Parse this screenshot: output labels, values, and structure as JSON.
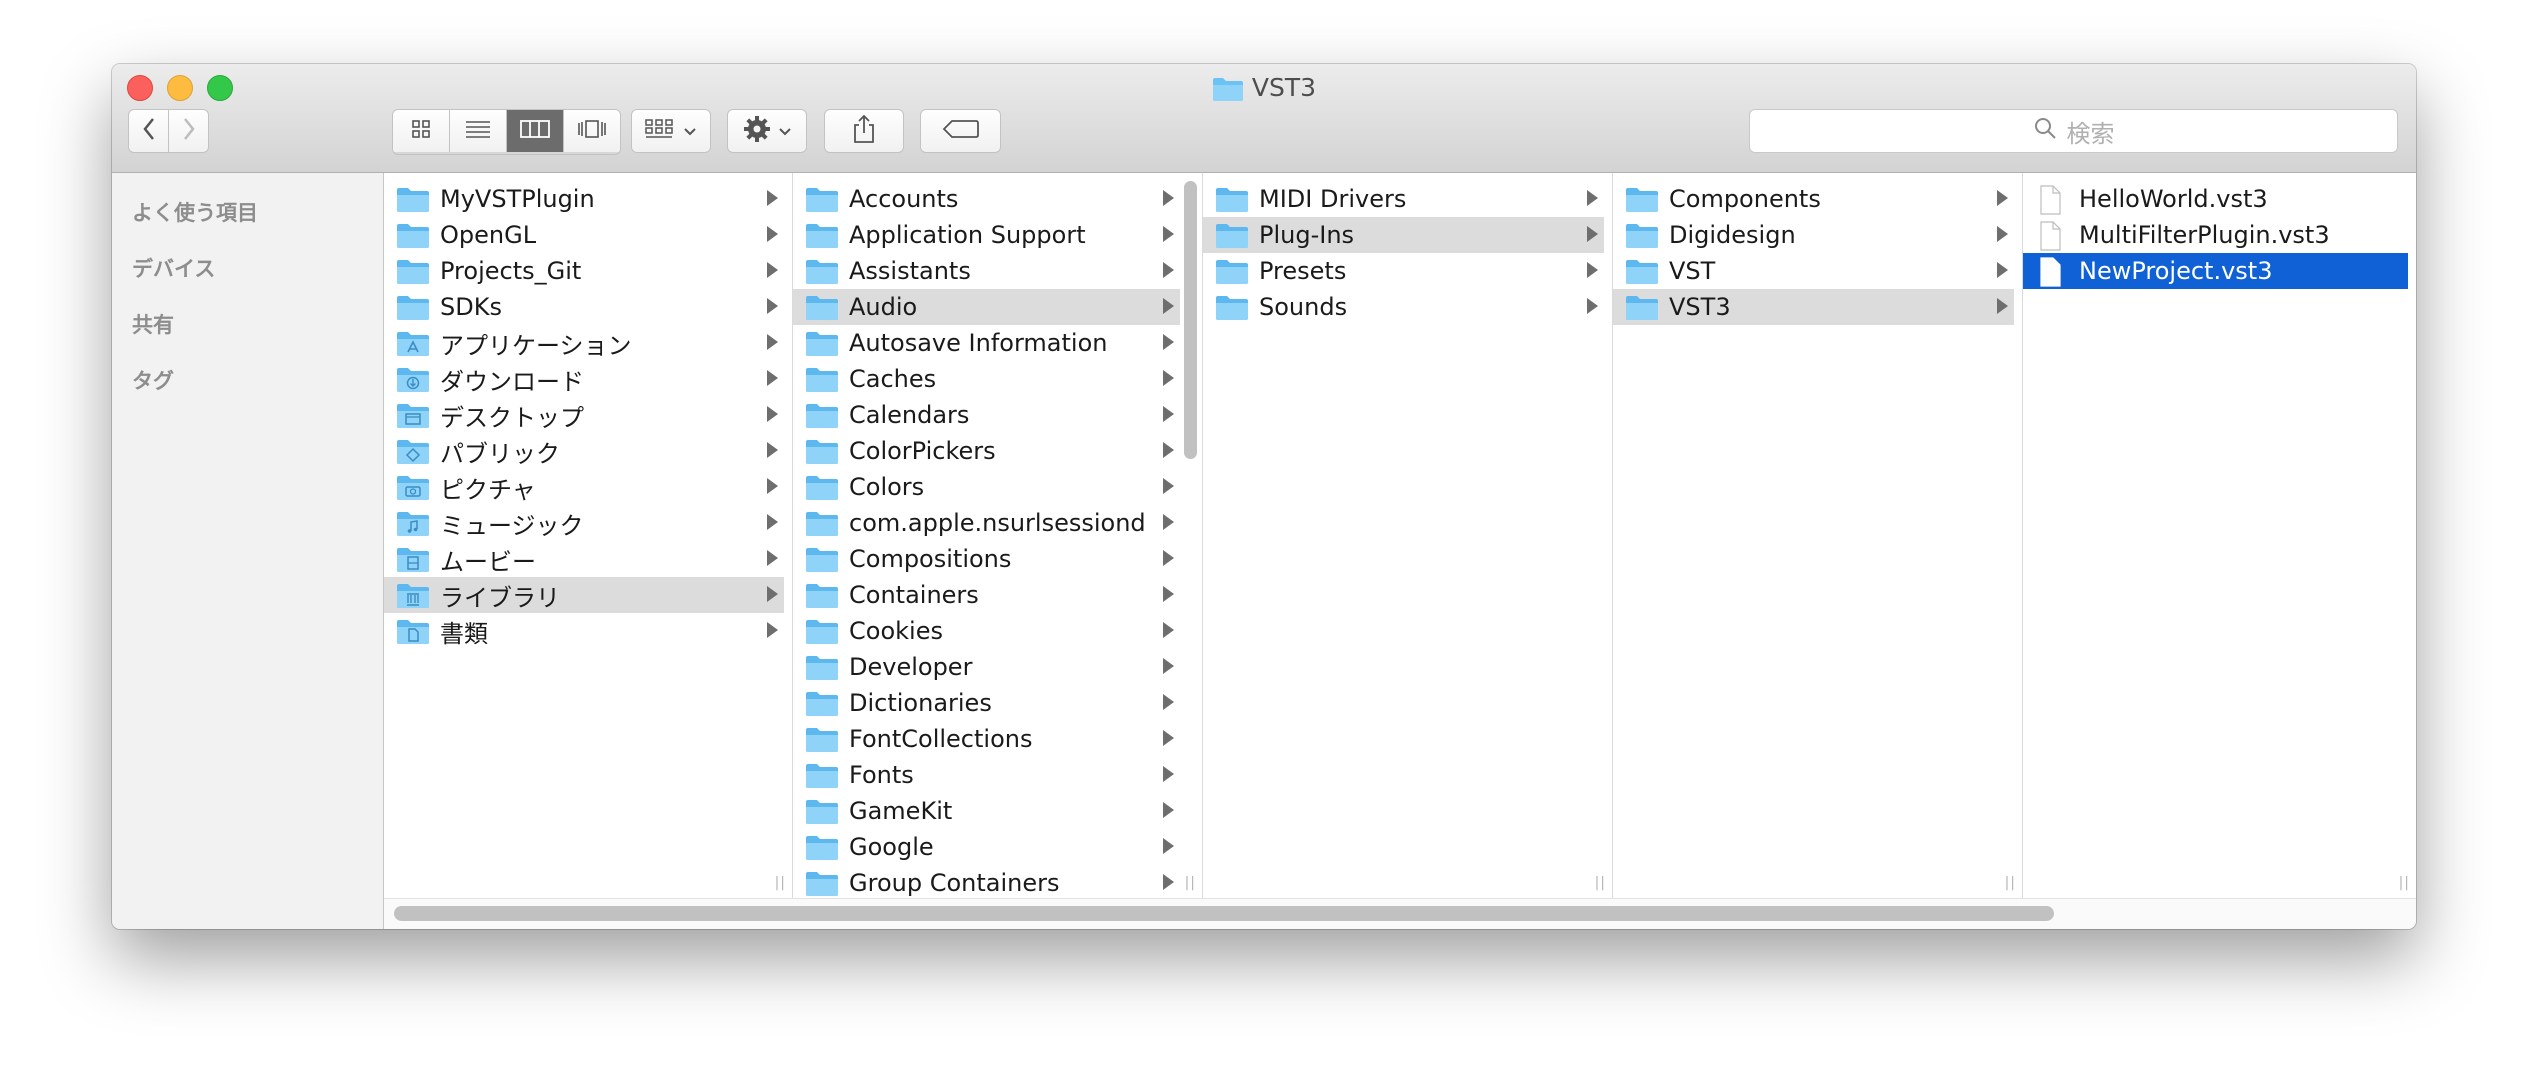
{
  "window": {
    "title": "VST3"
  },
  "toolbar": {
    "back_icon": "chevron-left-icon",
    "forward_icon": "chevron-right-icon",
    "view_modes": [
      "icon-view-icon",
      "list-view-icon",
      "column-view-icon",
      "cover-flow-icon"
    ],
    "active_view": "column-view-icon",
    "arrange_icon": "arrange-icon",
    "action_icon": "gear-icon",
    "share_icon": "share-icon",
    "tag_icon": "tag-icon",
    "search_placeholder": "検索"
  },
  "sidebar": {
    "sections": [
      "よく使う項目",
      "デバイス",
      "共有",
      "タグ"
    ]
  },
  "colors": {
    "folder": "#6cc3f3",
    "selection_blue": "#1061d6",
    "selection_gray": "#dcdcdc"
  },
  "columns": [
    {
      "items": [
        {
          "label": "MyVSTPlugin",
          "icon": "folder"
        },
        {
          "label": "OpenGL",
          "icon": "folder"
        },
        {
          "label": "Projects_Git",
          "icon": "folder"
        },
        {
          "label": "SDKs",
          "icon": "folder"
        },
        {
          "label": "アプリケーション",
          "icon": "applications-folder"
        },
        {
          "label": "ダウンロード",
          "icon": "downloads-folder"
        },
        {
          "label": "デスクトップ",
          "icon": "desktop-folder"
        },
        {
          "label": "パブリック",
          "icon": "public-folder"
        },
        {
          "label": "ピクチャ",
          "icon": "pictures-folder"
        },
        {
          "label": "ミュージック",
          "icon": "music-folder"
        },
        {
          "label": "ムービー",
          "icon": "movies-folder"
        },
        {
          "label": "ライブラリ",
          "icon": "library-folder",
          "selected": "gray"
        },
        {
          "label": "書類",
          "icon": "documents-folder"
        }
      ]
    },
    {
      "items": [
        {
          "label": "Accounts",
          "icon": "folder"
        },
        {
          "label": "Application Support",
          "icon": "folder"
        },
        {
          "label": "Assistants",
          "icon": "folder"
        },
        {
          "label": "Audio",
          "icon": "folder",
          "selected": "gray"
        },
        {
          "label": "Autosave Information",
          "icon": "folder"
        },
        {
          "label": "Caches",
          "icon": "folder"
        },
        {
          "label": "Calendars",
          "icon": "folder"
        },
        {
          "label": "ColorPickers",
          "icon": "folder"
        },
        {
          "label": "Colors",
          "icon": "folder"
        },
        {
          "label": "com.apple.nsurlsessiond",
          "icon": "folder"
        },
        {
          "label": "Compositions",
          "icon": "folder"
        },
        {
          "label": "Containers",
          "icon": "folder"
        },
        {
          "label": "Cookies",
          "icon": "folder"
        },
        {
          "label": "Developer",
          "icon": "folder"
        },
        {
          "label": "Dictionaries",
          "icon": "folder"
        },
        {
          "label": "FontCollections",
          "icon": "folder"
        },
        {
          "label": "Fonts",
          "icon": "folder"
        },
        {
          "label": "GameKit",
          "icon": "folder"
        },
        {
          "label": "Google",
          "icon": "folder"
        },
        {
          "label": "Group Containers",
          "icon": "folder"
        }
      ]
    },
    {
      "items": [
        {
          "label": "MIDI Drivers",
          "icon": "folder"
        },
        {
          "label": "Plug-Ins",
          "icon": "folder",
          "selected": "gray"
        },
        {
          "label": "Presets",
          "icon": "folder"
        },
        {
          "label": "Sounds",
          "icon": "folder"
        }
      ]
    },
    {
      "items": [
        {
          "label": "Components",
          "icon": "folder"
        },
        {
          "label": "Digidesign",
          "icon": "folder"
        },
        {
          "label": "VST",
          "icon": "folder"
        },
        {
          "label": "VST3",
          "icon": "folder",
          "selected": "gray"
        }
      ]
    },
    {
      "items": [
        {
          "label": "HelloWorld.vst3",
          "icon": "document"
        },
        {
          "label": "MultiFilterPlugin.vst3",
          "icon": "document"
        },
        {
          "label": "NewProject.vst3",
          "icon": "document",
          "selected": "blue"
        }
      ]
    }
  ]
}
